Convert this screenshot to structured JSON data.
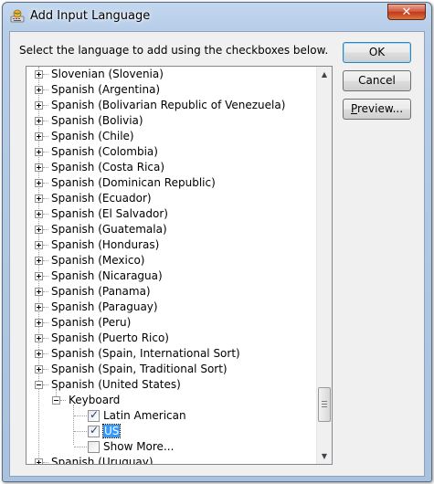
{
  "window": {
    "title": "Add Input Language"
  },
  "instruction": "Select the language to add using the checkboxes below.",
  "buttons": {
    "ok": "OK",
    "cancel": "Cancel",
    "preview_prefix": "",
    "preview_accel": "P",
    "preview_rest": "review..."
  },
  "tree": {
    "languages": [
      "Slovenian (Slovenia)",
      "Spanish (Argentina)",
      "Spanish (Bolivarian Republic of Venezuela)",
      "Spanish (Bolivia)",
      "Spanish (Chile)",
      "Spanish (Colombia)",
      "Spanish (Costa Rica)",
      "Spanish (Dominican Republic)",
      "Spanish (Ecuador)",
      "Spanish (El Salvador)",
      "Spanish (Guatemala)",
      "Spanish (Honduras)",
      "Spanish (Mexico)",
      "Spanish (Nicaragua)",
      "Spanish (Panama)",
      "Spanish (Paraguay)",
      "Spanish (Peru)",
      "Spanish (Puerto Rico)",
      "Spanish (Spain, International Sort)",
      "Spanish (Spain, Traditional Sort)"
    ],
    "expanded_language": "Spanish (United States)",
    "keyboard_group": "Keyboard",
    "keyboard_items": [
      {
        "label": "Latin American",
        "checked": true
      },
      {
        "label": "US",
        "checked": true,
        "selected": true
      },
      {
        "label": "Show More...",
        "checked": false
      }
    ],
    "last_language": "Spanish (Uruguay)"
  },
  "scrollbar": {
    "position_fraction": 0.92
  },
  "colors": {
    "selection": "#3399ff",
    "close_button": "#c3371b"
  },
  "icons": {
    "app": "keyboard-globe-icon",
    "close": "close-icon"
  }
}
